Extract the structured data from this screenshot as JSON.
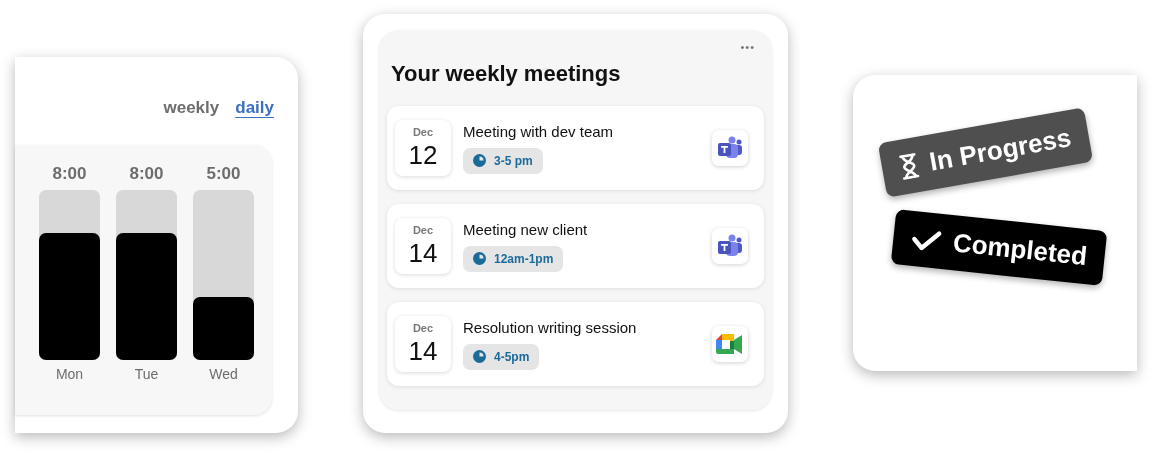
{
  "hours_card": {
    "tabs": [
      {
        "label": "weekly",
        "selected": false
      },
      {
        "label": "daily",
        "selected": true
      }
    ],
    "bars": [
      {
        "value": "8:00",
        "day": "Mon",
        "level": 0.75
      },
      {
        "value": "8:00",
        "day": "Tue",
        "level": 0.75
      },
      {
        "value": "5:00",
        "day": "Wed",
        "level": 0.37
      }
    ]
  },
  "meetings_card": {
    "menu": "•••",
    "title": "Your weekly meetings",
    "meetings": [
      {
        "month": "Dec",
        "day": "12",
        "title": "Meeting with dev team",
        "time": "3-5 pm",
        "kind": "teams"
      },
      {
        "month": "Dec",
        "day": "14",
        "title": "Meeting new client",
        "time": "12am-1pm",
        "kind": "teams"
      },
      {
        "month": "Dec",
        "day": "14",
        "title": "Resolution writing session",
        "time": "4-5pm",
        "kind": "meet"
      }
    ]
  },
  "status_card": {
    "badges": [
      {
        "label": "In Progress",
        "kind": "in_progress"
      },
      {
        "label": "Completed",
        "kind": "completed"
      }
    ]
  }
}
